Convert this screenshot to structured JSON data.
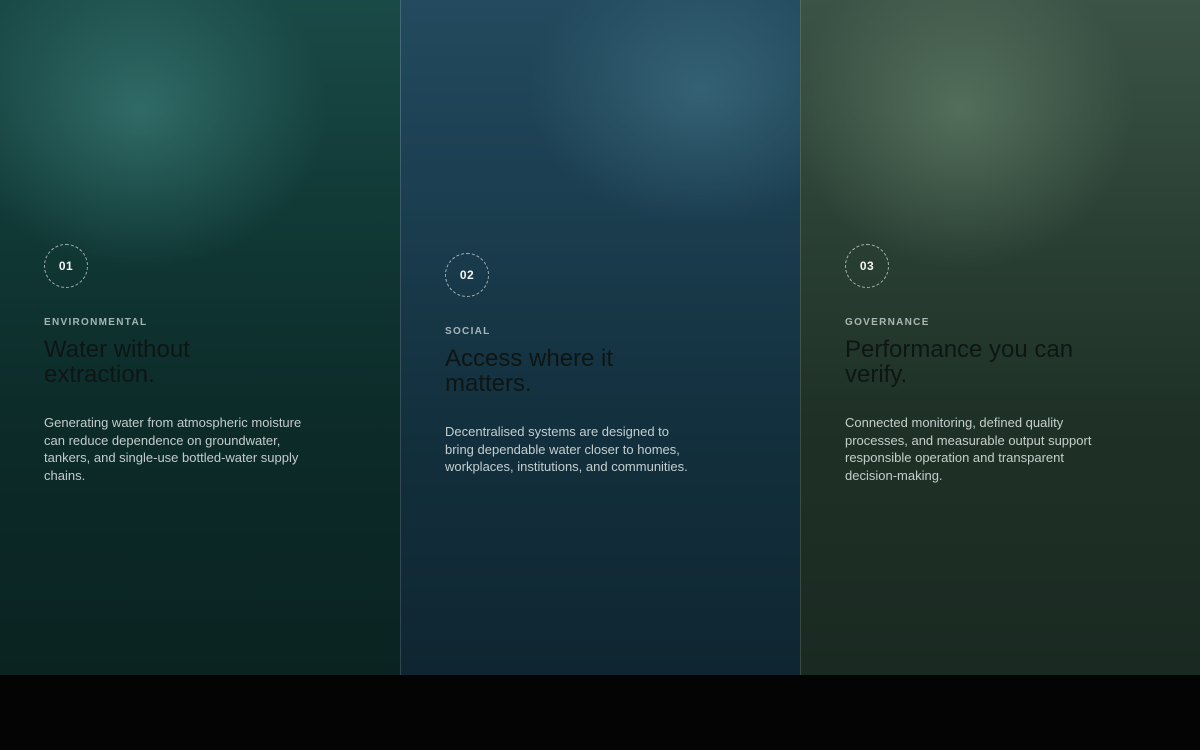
{
  "pillars": [
    {
      "number": "01",
      "category": "ENVIRONMENTAL",
      "title": "Water without extraction.",
      "description": "Generating water from atmospheric moisture can reduce dependence on groundwater, tankers, and single-use bottled-water supply chains."
    },
    {
      "number": "02",
      "category": "SOCIAL",
      "title": "Access where it matters.",
      "description": "Decentralised systems are designed to bring dependable water closer to homes, workplaces, institutions, and communities."
    },
    {
      "number": "03",
      "category": "GOVERNANCE",
      "title": "Performance you can verify.",
      "description": "Connected monitoring, defined quality processes, and measurable output support responsible operation and transparent decision-making."
    }
  ]
}
